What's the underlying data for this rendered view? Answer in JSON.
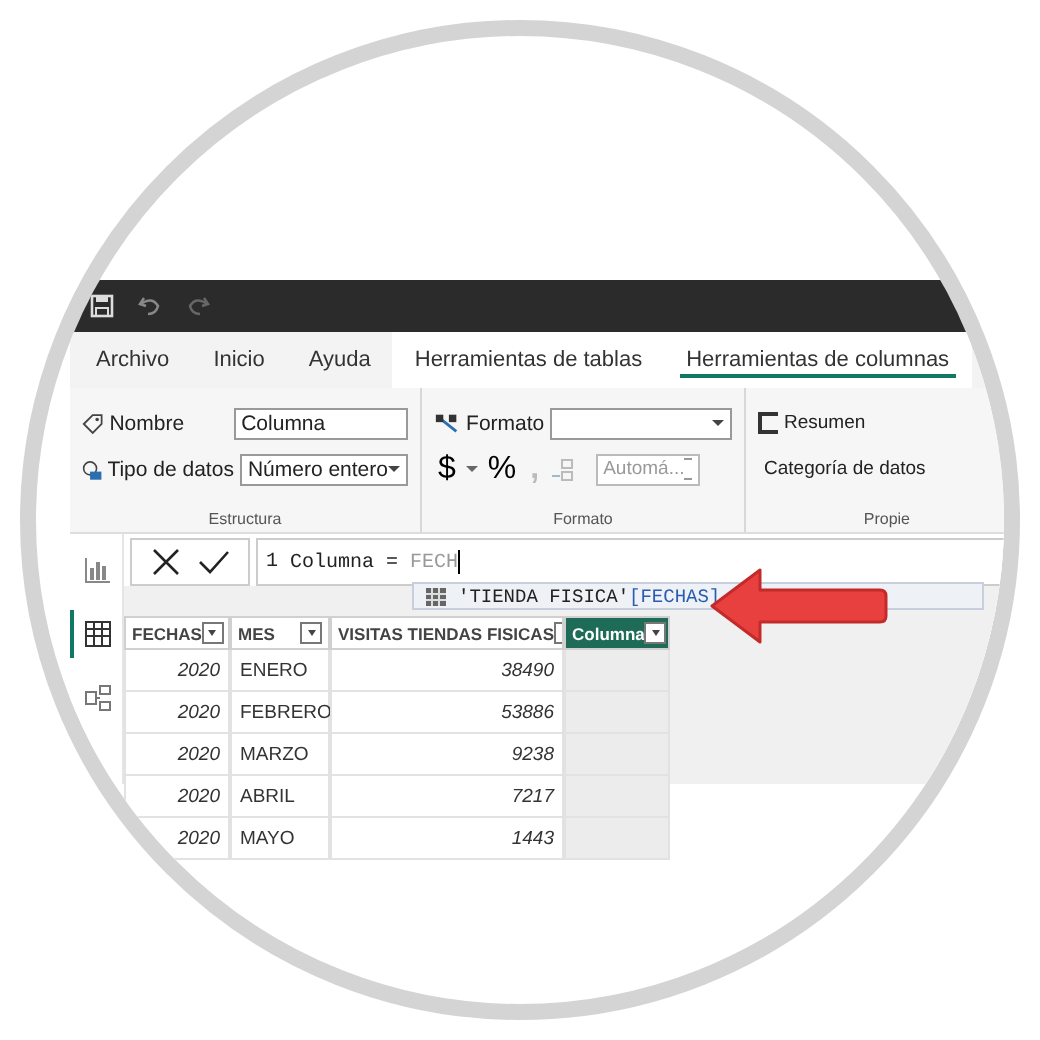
{
  "tabs": [
    {
      "label": "Archivo",
      "selected": false,
      "contextual": false
    },
    {
      "label": "Inicio",
      "selected": false,
      "contextual": false
    },
    {
      "label": "Ayuda",
      "selected": false,
      "contextual": false
    },
    {
      "label": "Herramientas de tablas",
      "selected": false,
      "contextual": true
    },
    {
      "label": "Herramientas de columnas",
      "selected": true,
      "contextual": true
    }
  ],
  "ribbon": {
    "estructura": {
      "label": "Estructura",
      "name_label": "Nombre",
      "name_value": "Columna",
      "type_label": "Tipo de datos",
      "type_value": "Número entero"
    },
    "formato": {
      "label": "Formato",
      "format_label": "Formato",
      "currency": "$",
      "percent": "%",
      "comma": ",",
      "auto_value": "Automá..."
    },
    "propiedades": {
      "label": "Propie",
      "summary": "Resumen",
      "category": "Categoría de datos"
    }
  },
  "sidebar": [
    {
      "kind": "report",
      "selected": false
    },
    {
      "kind": "table",
      "selected": true
    },
    {
      "kind": "model",
      "selected": false
    }
  ],
  "formula": {
    "line_number": "1",
    "text": "Columna = ",
    "typed": "FECH"
  },
  "suggestion": {
    "table": "'TIENDA FISICA'",
    "column": "[FECHAS]"
  },
  "table": {
    "columns": [
      {
        "label": "FECHAS",
        "selected": false
      },
      {
        "label": "MES",
        "selected": false
      },
      {
        "label": "VISITAS TIENDAS FISICAS",
        "selected": false
      },
      {
        "label": "Columna",
        "selected": true
      }
    ],
    "rows": [
      [
        "2020",
        "ENERO",
        "38490"
      ],
      [
        "2020",
        "FEBRERO",
        "53886"
      ],
      [
        "2020",
        "MARZO",
        "9238"
      ],
      [
        "2020",
        "ABRIL",
        "7217"
      ],
      [
        "2020",
        "MAYO",
        "1443"
      ]
    ]
  }
}
